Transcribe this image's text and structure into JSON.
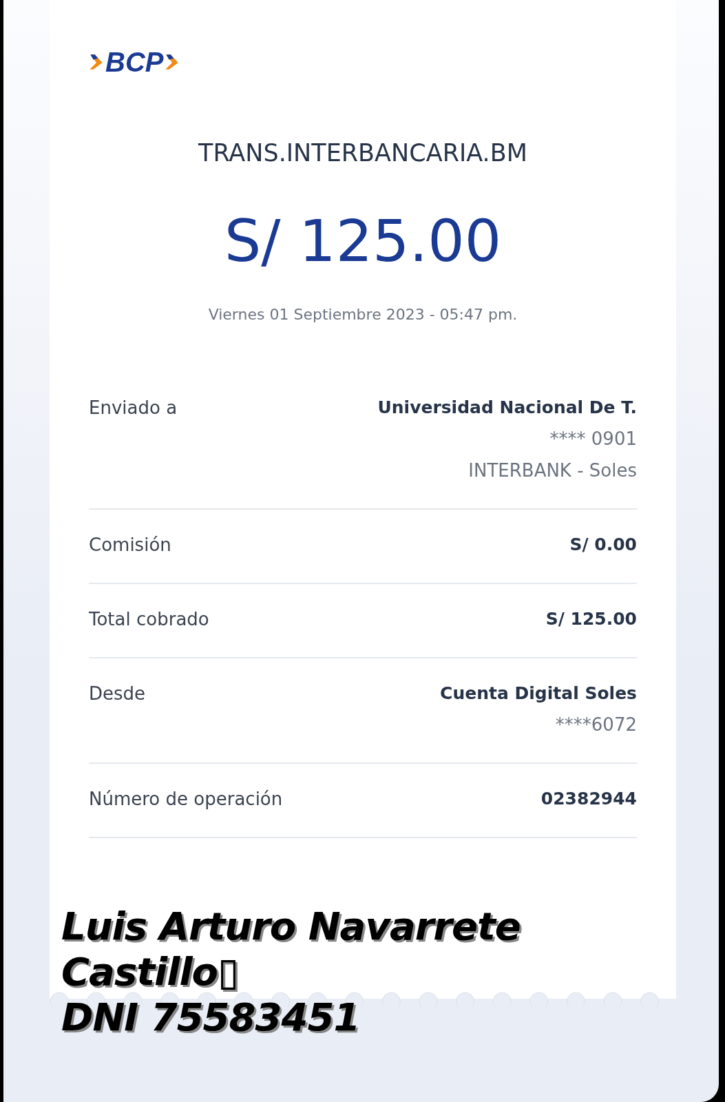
{
  "logo": {
    "text": "BCP"
  },
  "title": "TRANS.INTERBANCARIA.BM",
  "amount": "S/ 125.00",
  "date": "Viernes 01 Septiembre 2023 - 05:47 pm.",
  "rows": [
    {
      "label": "Enviado a",
      "values": [
        {
          "text": "Universidad Nacional De T.",
          "bold": true
        },
        {
          "text": "**** 0901",
          "bold": false
        },
        {
          "text": "INTERBANK - Soles",
          "bold": false
        }
      ]
    },
    {
      "label": "Comisión",
      "values": [
        {
          "text": "S/ 0.00",
          "bold": true
        }
      ]
    },
    {
      "label": "Total cobrado",
      "values": [
        {
          "text": "S/ 125.00",
          "bold": true
        }
      ]
    },
    {
      "label": "Desde",
      "values": [
        {
          "text": "Cuenta Digital Soles",
          "bold": true
        },
        {
          "text": "****6072",
          "bold": false
        }
      ]
    },
    {
      "label": "Número de operación",
      "values": [
        {
          "text": "02382944",
          "bold": true
        }
      ]
    }
  ],
  "overlay": [
    "Luis Arturo Navarrete",
    "Castillo▯",
    "DNI 75583451"
  ]
}
